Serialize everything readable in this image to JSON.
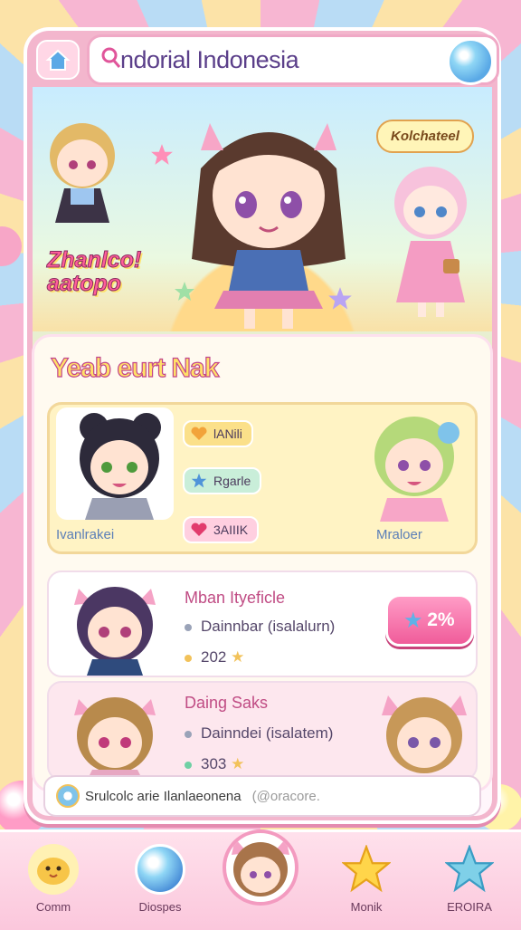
{
  "header": {
    "title": "ndorial Indonesia"
  },
  "hero": {
    "speech": "Kolchateel",
    "slogan_line1": "Zhanlco!",
    "slogan_line2": "aatopo"
  },
  "panel": {
    "title": "Yeab eurt Nak",
    "team": {
      "left_name": "Ivanlrakei",
      "right_name": "Mraloer",
      "tags": [
        {
          "label": "lANili",
          "icon": "heart-icon"
        },
        {
          "label": "Rgarle",
          "icon": "star-icon"
        },
        {
          "label": "3AIIIK",
          "icon": "heart-icon"
        }
      ]
    },
    "rows": [
      {
        "title": "Mban Ityeficle",
        "sub": "Dainnbar (isalalurn)",
        "value": "202",
        "badge": "2%"
      },
      {
        "title": "Daing Saks",
        "sub": "Dainndei (isalatem)",
        "value": "303"
      }
    ]
  },
  "chat": {
    "text": "Srulcolc arie Ilanlaeonena",
    "user": "(@oracore."
  },
  "nav": {
    "items": [
      {
        "label": "Comm",
        "icon": "chick-icon"
      },
      {
        "label": "Diospes",
        "icon": "orb-icon"
      },
      {
        "label": "Monik",
        "icon": "star-icon"
      },
      {
        "label": "EROIRA",
        "icon": "star-icon"
      }
    ]
  },
  "colors": {
    "accent_pink": "#f05c9a",
    "frame_pink": "#f3b6cd",
    "title_purple": "#5b3f8a"
  }
}
